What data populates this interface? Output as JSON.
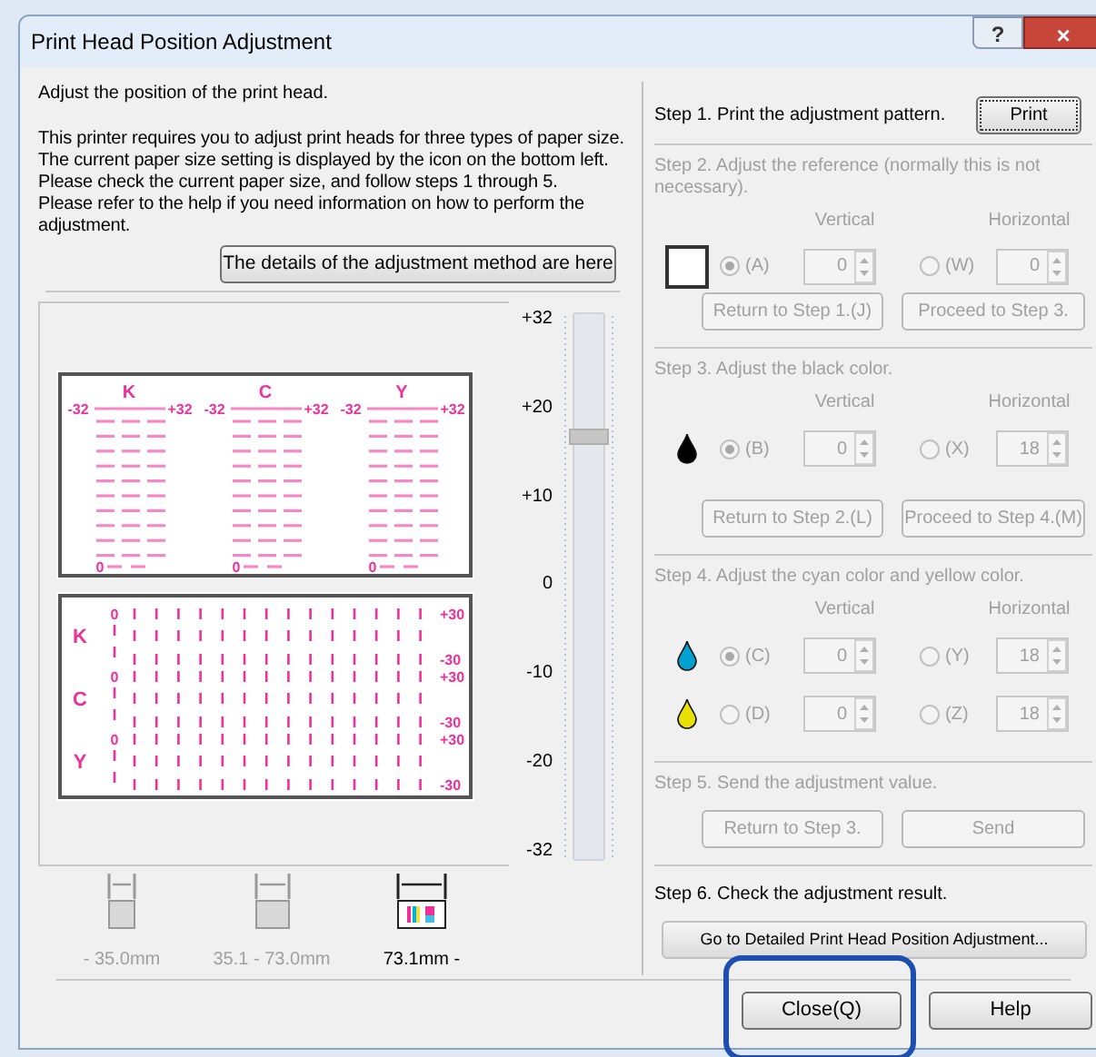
{
  "window": {
    "title": "Print Head Position Adjustment",
    "controls": [
      "?",
      "×"
    ]
  },
  "intro": "Adjust the position of the print head.",
  "description": "This printer requires you to adjust print heads for three types of paper size.\nThe current paper size setting is displayed by the icon on the bottom left.\nPlease check the current paper size, and follow steps 1 through 5.\nPlease refer to the help if you need information on how to perform the\nadjustment.",
  "details_button": "The details of the adjustment method are here",
  "pattern": {
    "top_columns": [
      {
        "label": "K",
        "min": "-32",
        "max": "+32",
        "zero": "0"
      },
      {
        "label": "C",
        "min": "-32",
        "max": "+32",
        "zero": "0"
      },
      {
        "label": "Y",
        "min": "-32",
        "max": "+32",
        "zero": "0"
      }
    ],
    "bottom_rows": [
      {
        "label": "K",
        "zero": "0",
        "max": "+30",
        "min": "-30"
      },
      {
        "label": "C",
        "zero": "0",
        "max": "+30",
        "min": "-30"
      },
      {
        "label": "Y",
        "zero": "0",
        "max": "+30",
        "min": "-30"
      }
    ]
  },
  "slider": {
    "ticks": [
      "+32",
      "+20",
      "+10",
      "0",
      "-10",
      "-20",
      "-32"
    ],
    "level": 0.78
  },
  "paper_sizes": [
    {
      "label": "- 35.0mm",
      "selected": false
    },
    {
      "label": "35.1 - 73.0mm",
      "selected": false
    },
    {
      "label": "73.1mm -",
      "selected": true
    }
  ],
  "steps": [
    {
      "kind": "print",
      "title": "Step 1. Print the adjustment pattern.",
      "enabled": true,
      "button": "Print"
    },
    {
      "kind": "adjust",
      "title": "Step 2. Adjust the reference (normally this is not necessary).",
      "enabled": false,
      "columns": [
        "Vertical",
        "Horizontal"
      ],
      "rows": [
        {
          "kind": "square",
          "vertical": {
            "label": "(A)",
            "checked": true,
            "value": "0"
          },
          "horizontal": {
            "label": "(W)",
            "checked": false,
            "value": "0"
          }
        }
      ],
      "buttons": [
        "Return to Step 1.(J)",
        "Proceed to Step 3."
      ]
    },
    {
      "kind": "adjust",
      "title": "Step 3. Adjust the black color.",
      "enabled": false,
      "columns": [
        "Vertical",
        "Horizontal"
      ],
      "rows": [
        {
          "kind": "drop",
          "color": "#000000",
          "vertical": {
            "label": "(B)",
            "checked": true,
            "value": "0"
          },
          "horizontal": {
            "label": "(X)",
            "checked": false,
            "value": "18"
          }
        }
      ],
      "buttons": [
        "Return to Step 2.(L)",
        "Proceed to Step 4.(M)"
      ]
    },
    {
      "kind": "adjust",
      "title": "Step 4. Adjust the cyan color and yellow color.",
      "enabled": false,
      "columns": [
        "Vertical",
        "Horizontal"
      ],
      "rows": [
        {
          "kind": "drop",
          "color": "#00a0d0",
          "vertical": {
            "label": "(C)",
            "checked": true,
            "value": "0"
          },
          "horizontal": {
            "label": "(Y)",
            "checked": false,
            "value": "18"
          }
        },
        {
          "kind": "drop",
          "color": "#e8e000",
          "vertical": {
            "label": "(D)",
            "checked": false,
            "value": "0"
          },
          "horizontal": {
            "label": "(Z)",
            "checked": false,
            "value": "18"
          }
        }
      ]
    },
    {
      "kind": "adjust",
      "title": "Step 5. Send the adjustment value.",
      "enabled": false,
      "buttons": [
        "Return to Step 3.",
        "Send"
      ]
    },
    {
      "kind": "result",
      "title": "Step 6. Check the adjustment result.",
      "enabled": true,
      "button": "Go to Detailed Print Head Position Adjustment..."
    }
  ],
  "buttons": [
    {
      "label": "Close(Q)",
      "highlighted": true
    },
    {
      "label": "Help",
      "highlighted": false
    }
  ]
}
